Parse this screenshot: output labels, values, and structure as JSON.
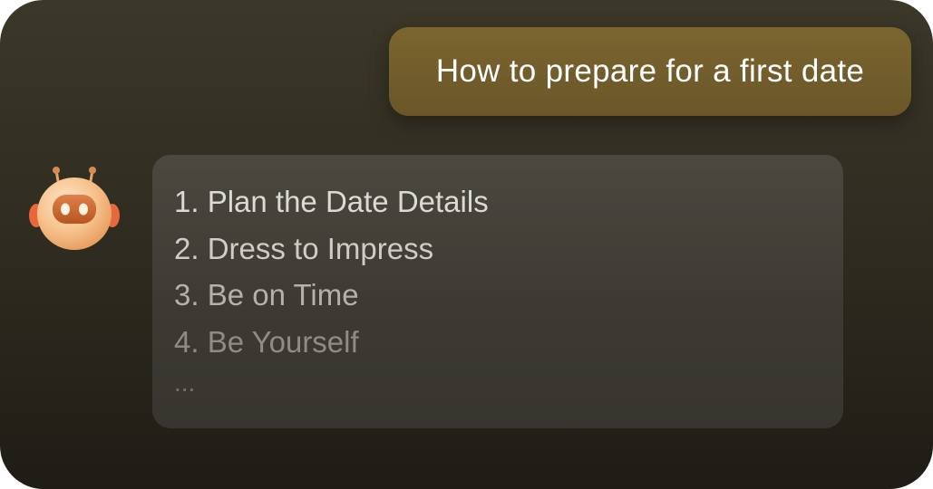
{
  "user_message": {
    "text": "How to prepare for a first date"
  },
  "assistant": {
    "avatar_icon": "robot-avatar-icon",
    "items": [
      "1. Plan the Date Details",
      "2. Dress to Impress",
      "3. Be on Time",
      "4. Be Yourself",
      "..."
    ]
  },
  "colors": {
    "background_top": "#3b3829",
    "background_bottom": "#1f1c16",
    "user_bubble": "#75602e",
    "assistant_bubble": "#45423b",
    "user_text": "#ffffff"
  }
}
